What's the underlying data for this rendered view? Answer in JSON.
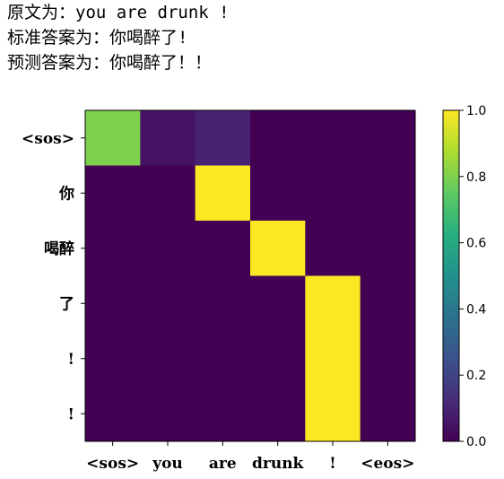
{
  "header": {
    "line1": "原文为：you are drunk !",
    "line2": "标准答案为：你喝醉了!",
    "line3": "预测答案为：你喝醉了！！"
  },
  "chart_data": {
    "type": "heatmap",
    "x_labels": [
      "<sos>",
      "you",
      "are",
      "drunk",
      "!",
      "<eos>"
    ],
    "y_labels": [
      "<sos>",
      "你",
      "喝醉",
      "了",
      "!",
      "!"
    ],
    "values": [
      [
        0.8,
        0.05,
        0.1,
        0.0,
        0.0,
        0.0
      ],
      [
        0.0,
        0.0,
        1.0,
        0.0,
        0.0,
        0.0
      ],
      [
        0.0,
        0.0,
        0.0,
        1.0,
        0.0,
        0.0
      ],
      [
        0.0,
        0.0,
        0.0,
        0.0,
        1.0,
        0.0
      ],
      [
        0.0,
        0.0,
        0.0,
        0.0,
        1.0,
        0.0
      ],
      [
        0.0,
        0.0,
        0.0,
        0.0,
        1.0,
        0.0
      ]
    ],
    "colorbar": {
      "ticks": [
        "0.0",
        "0.2",
        "0.4",
        "0.6",
        "0.8",
        "1.0"
      ],
      "range": [
        0,
        1
      ]
    },
    "colormap": "viridis"
  }
}
